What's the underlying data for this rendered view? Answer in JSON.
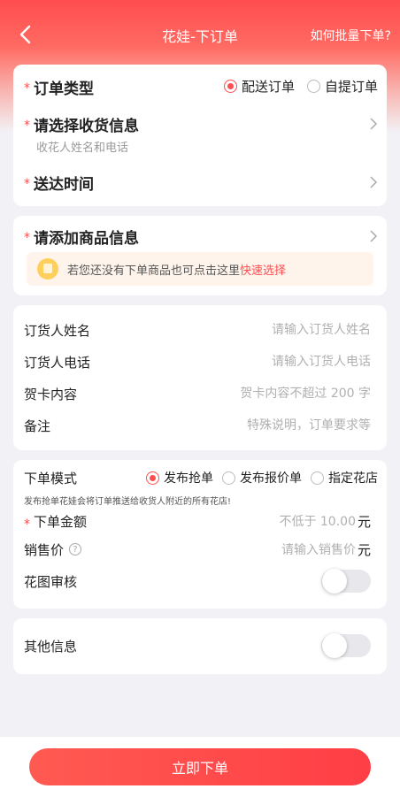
{
  "header": {
    "title": "花娃-下订单",
    "batch_link": "如何批量下单?"
  },
  "delivery": {
    "order_type_label": "订单类型",
    "order_type_options": [
      "配送订单",
      "自提订单"
    ],
    "order_type_selected": "配送订单",
    "receiver_label": "请选择收货信息",
    "receiver_placeholder": "收花人姓名和电话",
    "time_label": "送达时间"
  },
  "goods": {
    "label": "请添加商品信息",
    "tip_text": "若您还没有下单商品也可点击这里",
    "tip_link": "快速选择"
  },
  "orderer": {
    "name_label": "订货人姓名",
    "name_placeholder": "请输入订货人姓名",
    "phone_label": "订货人电话",
    "phone_placeholder": "请输入订货人电话",
    "card_label": "贺卡内容",
    "card_placeholder": "贺卡内容不超过 200 字",
    "remark_label": "备注",
    "remark_placeholder": "特殊说明，订单要求等"
  },
  "mode": {
    "label": "下单模式",
    "options": [
      "发布抢单",
      "发布报价单",
      "指定花店"
    ],
    "selected": "发布抢单",
    "note": "发布抢单花娃会将订单推送给收货人附近的所有花店!",
    "amount_label": "下单金额",
    "amount_placeholder": "不低于 10.00",
    "amount_unit": "元",
    "price_label": "销售价",
    "price_placeholder": "请输入销售价",
    "price_unit": "元",
    "review_label": "花图审核",
    "review_on": false
  },
  "other": {
    "label": "其他信息",
    "on": false
  },
  "footer": {
    "submit_label": "立即下单"
  },
  "colors": {
    "accent": "#ff4d4f"
  }
}
